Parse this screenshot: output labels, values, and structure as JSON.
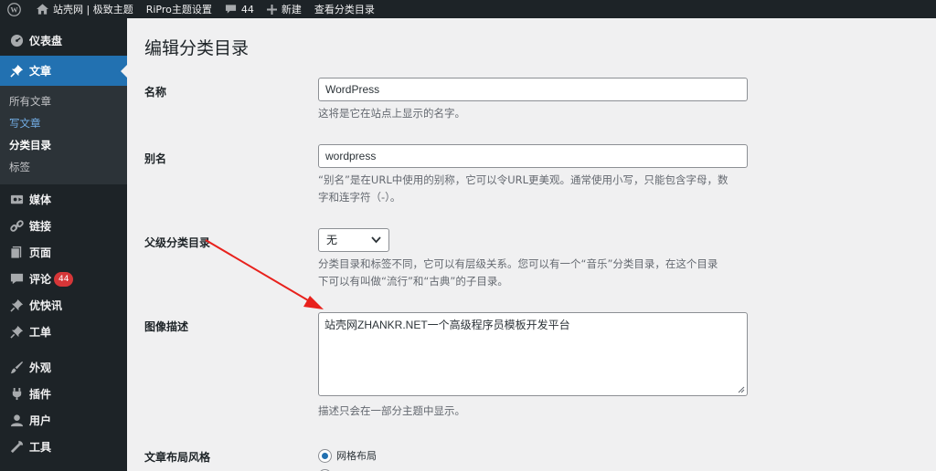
{
  "adminbar": {
    "site_name": "站壳网 | 极致主题",
    "theme_settings": "RiPro主题设置",
    "comments_count": "44",
    "new_label": "新建",
    "view_label": "查看分类目录"
  },
  "sidebar": {
    "dashboard": "仪表盘",
    "posts": "文章",
    "sub": {
      "all_posts": "所有文章",
      "write_post": "写文章",
      "categories": "分类目录",
      "tags": "标签"
    },
    "media": "媒体",
    "links": "链接",
    "pages": "页面",
    "comments": "评论",
    "comments_badge": "44",
    "youkuaixun": "优快讯",
    "tickets": "工单",
    "appearance": "外观",
    "plugins": "插件",
    "users": "用户",
    "tools": "工具"
  },
  "page": {
    "title": "编辑分类目录",
    "name_label": "名称",
    "name_value": "WordPress",
    "name_desc": "这将是它在站点上显示的名字。",
    "slug_label": "别名",
    "slug_value": "wordpress",
    "slug_desc_1": "“别名”是在URL中使用的别称，它可以令URL更美观。通常使用小写，只能包含字母，数",
    "slug_desc_2": "字和连字符（-）。",
    "parent_label": "父级分类目录",
    "parent_value": "无",
    "parent_desc_1": "分类目录和标签不同，它可以有层级关系。您可以有一个“音乐”分类目录，在这个目录",
    "parent_desc_2": "下可以有叫做“流行”和“古典”的子目录。",
    "image_desc_label": "图像描述",
    "image_desc_value": "站壳网ZHANKR.NET一个高级程序员模板开发平台",
    "image_desc_help": "描述只会在一部分主题中显示。",
    "layout_label": "文章布局风格",
    "layout_option_1": "网格布局"
  },
  "colors": {
    "adminbar_bg": "#1d2327",
    "menu_current": "#2271b1",
    "badge": "#d63638",
    "annotation_arrow": "#e8211c"
  }
}
